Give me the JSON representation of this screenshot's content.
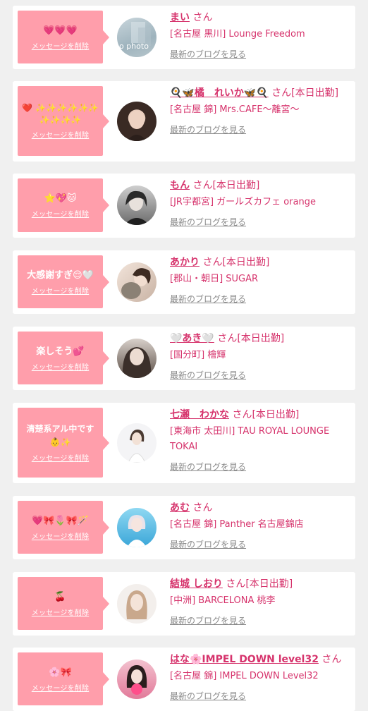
{
  "delete_label": "メッセージを削除",
  "blog_label": "最新のブログを見る",
  "colors": {
    "bubble": "#ff9eab",
    "accent": "#d6336c",
    "background": "#f0f0f0"
  },
  "entries": [
    {
      "message": "💗💗💗",
      "name": "まい",
      "suffix": "さん",
      "shop": "[名古屋 黒川] Lounge Freedom",
      "avatar_text": "no photo"
    },
    {
      "message": "❤️ ✨✨✨✨✨✨ ✨✨✨✨",
      "name": "🍳🦋橘　れいか🦋🍳",
      "suffix": "さん[本日出勤]",
      "shop": "[名古屋 錦] Mrs.CAFE〜離宮〜"
    },
    {
      "message": "⭐💖🐱",
      "name": "もん",
      "suffix": "さん[本日出勤]",
      "shop": "[JR宇都宮] ガールズカフェ orange"
    },
    {
      "message": "大感謝すぎ😌🤍",
      "name": "あかり",
      "suffix": "さん[本日出勤]",
      "shop": "[郡山・朝日] SUGAR"
    },
    {
      "message": "楽しそう💕",
      "name": "🤍あき🤍",
      "suffix": "さん[本日出勤]",
      "shop": "[国分町] 檜輝"
    },
    {
      "message": "清楚系アル中です 👶✨",
      "name": "七瀬　わかな",
      "suffix": "さん[本日出勤]",
      "shop": "[東海市 太田川] TAU ROYAL LOUNGE TOKAI"
    },
    {
      "message": "💗🎀🌷🎀🪄",
      "name": "あむ",
      "suffix": "さん",
      "shop": "[名古屋 錦] Panther 名古屋錦店"
    },
    {
      "message": "🍒",
      "name": "結城 しおり",
      "suffix": "さん[本日出勤]",
      "shop": "[中洲] BARCELONA 桃李"
    },
    {
      "message": "🌸🎀",
      "name": "はな🌸IMPEL DOWN level32",
      "suffix": "さん",
      "shop": "[名古屋 錦] IMPEL DOWN Level32"
    }
  ]
}
